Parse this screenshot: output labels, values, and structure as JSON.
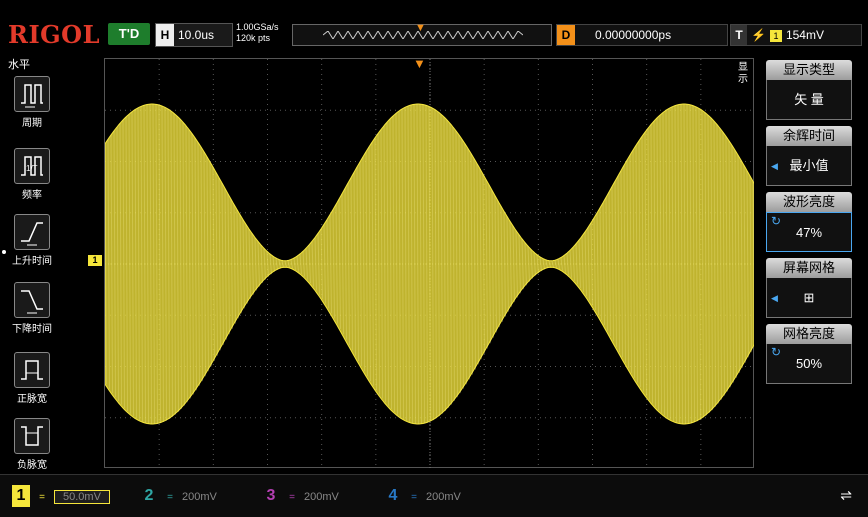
{
  "header": {
    "brand": "RIGOL",
    "trigger_status": "T'D",
    "timebase_tag": "H",
    "timebase": "10.0us",
    "sample_rate": "1.00GSa/s",
    "memory_depth": "120k pts",
    "delay_tag": "D",
    "delay": "0.00000000ps",
    "trigger_tag": "T",
    "trigger_source": "1",
    "trigger_level": "154mV"
  },
  "measure_panel": {
    "title": "水平",
    "items": [
      {
        "label": "周期",
        "icon": "period-icon"
      },
      {
        "label": "频率",
        "icon": "frequency-icon"
      },
      {
        "label": "上升时间",
        "icon": "rise-time-icon"
      },
      {
        "label": "下降时间",
        "icon": "fall-time-icon"
      },
      {
        "label": "正脉宽",
        "icon": "positive-width-icon"
      },
      {
        "label": "负脉宽",
        "icon": "negative-width-icon"
      }
    ]
  },
  "display_menu": {
    "side_title": "显示",
    "items": [
      {
        "title": "显示类型",
        "value": "矢 量"
      },
      {
        "title": "余辉时间",
        "value": "最小值"
      },
      {
        "title": "波形亮度",
        "value": "47%"
      },
      {
        "title": "屏幕网格",
        "value": "⊞"
      },
      {
        "title": "网格亮度",
        "value": "50%"
      }
    ]
  },
  "channels": [
    {
      "num": "1",
      "scale": "50.0mV",
      "color": "#f5e63b"
    },
    {
      "num": "2",
      "scale": "200mV",
      "color": "#2fa6a4"
    },
    {
      "num": "3",
      "scale": "200mV",
      "color": "#b43fb3"
    },
    {
      "num": "4",
      "scale": "200mV",
      "color": "#2879c6"
    }
  ],
  "waveform": {
    "ch1_marker": "1",
    "color": "#f5e63b"
  },
  "usb_icon": "usb-icon"
}
